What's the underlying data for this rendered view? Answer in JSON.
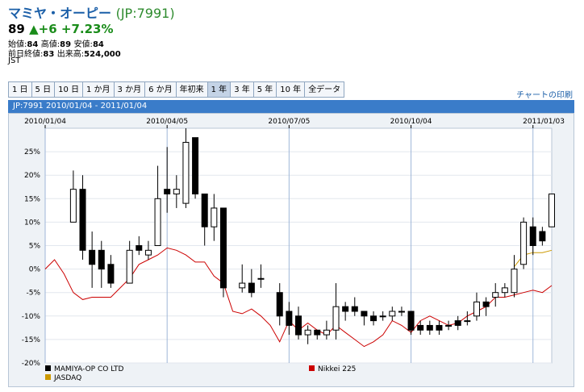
{
  "header": {
    "name": "マミヤ・オーピー",
    "code": "(JP:7991)",
    "price": "89",
    "change": "▲+6 +7.23%",
    "row1": [
      {
        "label": "始値:",
        "value": "84"
      },
      {
        "label": "高値:",
        "value": "89"
      },
      {
        "label": "安値:",
        "value": "84"
      }
    ],
    "row2": [
      {
        "label": "前日終値:",
        "value": "83"
      },
      {
        "label": "出来高:",
        "value": "524,000"
      }
    ],
    "tz": "JST"
  },
  "tabs": [
    {
      "label": "1 日",
      "active": false
    },
    {
      "label": "5 日",
      "active": false
    },
    {
      "label": "10 日",
      "active": false
    },
    {
      "label": "1 か月",
      "active": false
    },
    {
      "label": "3 か月",
      "active": false
    },
    {
      "label": "6 か月",
      "active": false
    },
    {
      "label": "年初来",
      "active": false
    },
    {
      "label": "1 年",
      "active": true
    },
    {
      "label": "3 年",
      "active": false
    },
    {
      "label": "5 年",
      "active": false
    },
    {
      "label": "10 年",
      "active": false
    },
    {
      "label": "全データ",
      "active": false
    }
  ],
  "print_link": "チャートの印刷",
  "chart_band": "JP:7991 2010/01/04 - 2011/01/04",
  "colors": {
    "candle": "#000000",
    "nikkei": "#cc0000",
    "jasdaq": "#cc9900",
    "band": "#3a7cc9"
  },
  "chart_data": {
    "type": "candlestick",
    "x_tick_labels": [
      "2010/01/04",
      "2010/04/05",
      "2010/07/05",
      "2010/10/04",
      "2011/01/03"
    ],
    "ylim": [
      -20,
      30
    ],
    "y_ticks": [
      -20,
      -15,
      -10,
      -5,
      0,
      5,
      10,
      15,
      20,
      25
    ],
    "y_tick_labels": [
      "-20%",
      "-15%",
      "-10%",
      "-5%",
      "0%",
      "5%",
      "10%",
      "15%",
      "20%",
      "25%"
    ],
    "grid": true,
    "legend_position": "bottom",
    "series": [
      {
        "name": "MAMIYA-OP CO LTD",
        "color": "#000000",
        "kind": "candles",
        "fields": [
          "week",
          "open",
          "close",
          "high",
          "low"
        ],
        "candles": [
          [
            3,
            10,
            17,
            21,
            10
          ],
          [
            4,
            17,
            4,
            20,
            2
          ],
          [
            5,
            4,
            1,
            8,
            -4
          ],
          [
            6,
            4,
            0,
            6,
            -4
          ],
          [
            7,
            1,
            -3,
            3,
            -4
          ],
          [
            9,
            -3,
            4,
            6,
            -3
          ],
          [
            10,
            5,
            4,
            7,
            3
          ],
          [
            11,
            3,
            4,
            6,
            2
          ],
          [
            12,
            5,
            15,
            22,
            5
          ],
          [
            13,
            17,
            16,
            26,
            12
          ],
          [
            14,
            16,
            17,
            20,
            13
          ],
          [
            15,
            14,
            27,
            30,
            13
          ],
          [
            16,
            28,
            16,
            28,
            15
          ],
          [
            17,
            16,
            9,
            16,
            5
          ],
          [
            18,
            9,
            13,
            16,
            6
          ],
          [
            19,
            13,
            -4,
            13,
            -6
          ],
          [
            21,
            -4,
            -3,
            1,
            -5
          ],
          [
            22,
            -3,
            -5,
            0,
            -6
          ],
          [
            23,
            -2,
            -2,
            1,
            -4
          ],
          [
            25,
            -5,
            -10,
            -3,
            -12
          ],
          [
            26,
            -9,
            -12,
            -7,
            -14
          ],
          [
            27,
            -10,
            -14,
            -8,
            -15
          ],
          [
            28,
            -14,
            -13,
            -12,
            -16
          ],
          [
            29,
            -13,
            -14,
            -13,
            -15
          ],
          [
            30,
            -14,
            -13,
            -11,
            -15
          ],
          [
            31,
            -13,
            -8,
            -3,
            -15
          ],
          [
            32,
            -8,
            -9,
            -7,
            -11
          ],
          [
            33,
            -8,
            -9,
            -6,
            -10
          ],
          [
            34,
            -9,
            -10,
            -9,
            -12
          ],
          [
            35,
            -10,
            -11,
            -9,
            -12
          ],
          [
            36,
            -10,
            -10,
            -9,
            -11
          ],
          [
            37,
            -10,
            -9,
            -8,
            -11
          ],
          [
            38,
            -9,
            -9,
            -8,
            -10
          ],
          [
            39,
            -9,
            -13,
            -9,
            -14
          ],
          [
            40,
            -12,
            -13,
            -11,
            -14
          ],
          [
            41,
            -12,
            -13,
            -11,
            -14
          ],
          [
            42,
            -12,
            -13,
            -11,
            -14
          ],
          [
            43,
            -12,
            -12,
            -11,
            -13
          ],
          [
            44,
            -11,
            -12,
            -10,
            -13
          ],
          [
            45,
            -11,
            -11,
            -9,
            -12
          ],
          [
            46,
            -10,
            -7,
            -5,
            -11
          ],
          [
            47,
            -7,
            -8,
            -6,
            -10
          ],
          [
            48,
            -6,
            -5,
            -3,
            -8
          ],
          [
            49,
            -5,
            -4,
            -3,
            -6
          ],
          [
            50,
            -5,
            0,
            3,
            -6
          ],
          [
            51,
            1,
            10,
            11,
            0
          ],
          [
            52,
            9,
            5,
            11,
            3
          ],
          [
            53,
            8,
            6,
            9,
            5
          ],
          [
            54,
            9,
            16,
            16,
            9
          ]
        ]
      },
      {
        "name": "Nikkei 225",
        "color": "#cc0000",
        "kind": "line",
        "x": [
          0,
          1,
          2,
          3,
          4,
          5,
          6,
          7,
          8,
          9,
          10,
          11,
          12,
          13,
          14,
          15,
          16,
          17,
          18,
          19,
          20,
          21,
          22,
          23,
          24,
          25,
          26,
          27,
          28,
          29,
          30,
          31,
          32,
          33,
          34,
          35,
          36,
          37,
          38,
          39,
          40,
          41,
          42,
          43,
          44,
          45,
          46,
          47,
          48,
          49,
          50,
          51,
          52,
          53,
          54
        ],
        "y": [
          0,
          2,
          -1,
          -5,
          -6.5,
          -6,
          -6,
          -6,
          -4,
          -2,
          1,
          2,
          3,
          4.5,
          4,
          3,
          1.5,
          1.5,
          -1.5,
          -3,
          -9,
          -9.5,
          -8.5,
          -10,
          -12,
          -15.5,
          -11,
          -13,
          -11.5,
          -13,
          -14,
          -12,
          -13.5,
          -15,
          -16.5,
          -15.5,
          -14,
          -11,
          -12,
          -13.5,
          -11,
          -10,
          -11,
          -12,
          -11.5,
          -10,
          -9,
          -8,
          -6,
          -6,
          -5.5,
          -5,
          -4.5,
          -5,
          -3.5
        ]
      },
      {
        "name": "JASDAQ",
        "color": "#cc9900",
        "kind": "line",
        "x": [
          50,
          51,
          52,
          53,
          54
        ],
        "y": [
          0.5,
          3,
          3.5,
          3.5,
          4
        ]
      }
    ]
  }
}
